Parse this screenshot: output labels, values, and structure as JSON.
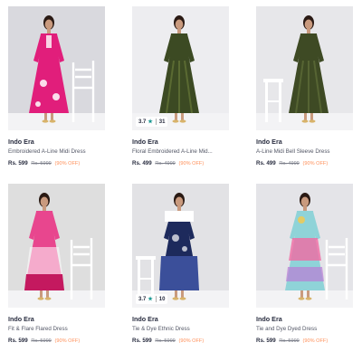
{
  "products": [
    {
      "brand": "Indo Era",
      "title": "Embroidered A-Line Midi Dress",
      "price": "Rs. 599",
      "mrp": "Rs. 5999",
      "discount": "(90% OFF)",
      "image": {
        "bg": "#d9d9de",
        "dress": "#e11e7b",
        "accent": "#ffffff"
      },
      "rating": null
    },
    {
      "brand": "Indo Era",
      "title": "Floral Embroidered A-Line Mid...",
      "price": "Rs. 499",
      "mrp": "Rs. 4999",
      "discount": "(90% OFF)",
      "image": {
        "bg": "#ededf0",
        "dress": "#3c4a23",
        "accent": "#5a6a32"
      },
      "rating": {
        "value": "3.7",
        "count": "31"
      }
    },
    {
      "brand": "Indo Era",
      "title": "A-Line Midi Bell Sleeve Dress",
      "price": "Rs. 499",
      "mrp": "Rs. 4999",
      "discount": "(90% OFF)",
      "image": {
        "bg": "#e7e7ea",
        "dress": "#3e4a24",
        "accent": "#566433"
      },
      "rating": null
    },
    {
      "brand": "Indo Era",
      "title": "Fit & Flare Flared Dress",
      "price": "Rs. 599",
      "mrp": "Rs. 5999",
      "discount": "(90% OFF)",
      "image": {
        "bg": "#dedede",
        "dress": "#e8468e",
        "accent": "#ffffff"
      },
      "rating": null
    },
    {
      "brand": "Indo Era",
      "title": "Tie & Dye Ethnic Dress",
      "price": "Rs. 599",
      "mrp": "Rs. 5999",
      "discount": "(90% OFF)",
      "image": {
        "bg": "#e2e2e5",
        "dress": "#1d2a5c",
        "accent": "#ffffff"
      },
      "rating": {
        "value": "3.7",
        "count": "10"
      }
    },
    {
      "brand": "Indo Era",
      "title": "Tie and Dye Dyed Dress",
      "price": "Rs. 599",
      "mrp": "Rs. 5999",
      "discount": "(90% OFF)",
      "image": {
        "bg": "#e4e4e8",
        "dress": "#8fd3d8",
        "accent": "#f06aa3"
      },
      "rating": null
    }
  ],
  "icons": {
    "rating_star": "star-icon"
  }
}
